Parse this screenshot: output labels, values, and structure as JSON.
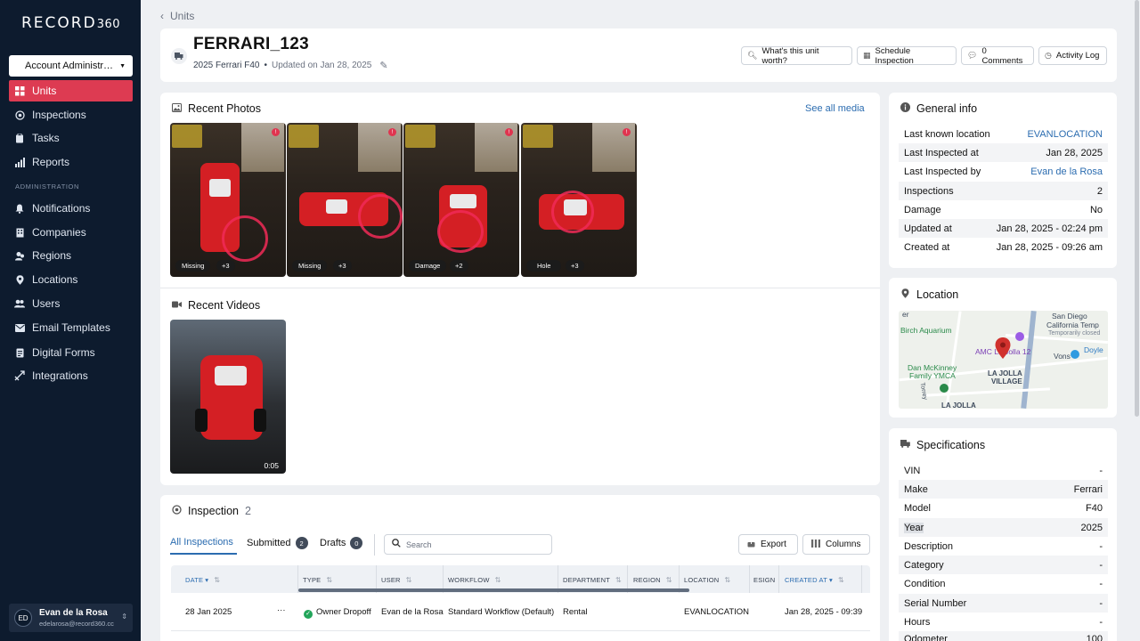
{
  "app": {
    "logo_main": "RECORD",
    "logo_num": "360"
  },
  "sidebar": {
    "account_label": "Account Administr…",
    "items": [
      {
        "label": "Units",
        "icon": "grid-icon"
      },
      {
        "label": "Inspections",
        "icon": "target-icon"
      },
      {
        "label": "Tasks",
        "icon": "clipboard-icon"
      },
      {
        "label": "Reports",
        "icon": "bar-chart-icon"
      },
      {
        "label": "Notifications",
        "icon": "bell-icon"
      },
      {
        "label": "Companies",
        "icon": "building-icon"
      },
      {
        "label": "Regions",
        "icon": "region-icon"
      },
      {
        "label": "Locations",
        "icon": "pin-icon"
      },
      {
        "label": "Users",
        "icon": "users-icon"
      },
      {
        "label": "Email Templates",
        "icon": "mail-icon"
      },
      {
        "label": "Digital Forms",
        "icon": "form-icon"
      },
      {
        "label": "Integrations",
        "icon": "integration-icon"
      }
    ],
    "section_admin": "ADMINISTRATION",
    "user": {
      "initials": "ED",
      "name": "Evan de la Rosa",
      "email": "edelarosa@record360.cc"
    }
  },
  "breadcrumb": {
    "back_label": "Units"
  },
  "unit": {
    "title": "FERRARI_123",
    "subtitle": "2025 Ferrari F40",
    "updated": "Updated on Jan 28, 2025"
  },
  "header_buttons": {
    "worth": "What's this unit worth?",
    "schedule": "Schedule Inspection",
    "comments": "0 Comments",
    "activity": "Activity Log"
  },
  "photos": {
    "title": "Recent Photos",
    "see_all": "See all media",
    "items": [
      {
        "tag": "Missing",
        "more": "+3"
      },
      {
        "tag": "Missing",
        "more": "+3"
      },
      {
        "tag": "Damage",
        "more": "+2"
      },
      {
        "tag": "Hole",
        "more": "+3"
      }
    ]
  },
  "videos": {
    "title": "Recent Videos",
    "items": [
      {
        "duration": "0:05"
      }
    ]
  },
  "general_info": {
    "title": "General info",
    "rows": [
      {
        "label": "Last known location",
        "value": "EVANLOCATION"
      },
      {
        "label": "Last Inspected at",
        "value": "Jan 28, 2025"
      },
      {
        "label": "Last Inspected by",
        "value": "Evan de la Rosa"
      },
      {
        "label": "Inspections",
        "value": "2"
      },
      {
        "label": "Damage",
        "value": "No"
      },
      {
        "label": "Updated at",
        "value": "Jan 28, 2025 - 02:24 pm"
      },
      {
        "label": "Created at",
        "value": "Jan 28, 2025 - 09:26 am"
      }
    ]
  },
  "location": {
    "title": "Location",
    "map_labels": {
      "aquarium": "Birch Aquarium",
      "sd": "San Diego",
      "california": "California Temp",
      "closed": "Temporarily closed",
      "amc": "AMC La Jolla 12",
      "vons": "Vons",
      "doyle": "Doyle",
      "dan1": "Dan McKinney",
      "dan2": "Family YMCA",
      "lj1": "LA JOLLA",
      "lj2": "VILLAGE",
      "lj3": "LA JOLLA",
      "torrey": "Torrey",
      "er": "er"
    }
  },
  "specifications": {
    "title": "Specifications",
    "rows": [
      {
        "label": "VIN",
        "value": "-"
      },
      {
        "label": "Make",
        "value": "Ferrari"
      },
      {
        "label": "Model",
        "value": "F40"
      },
      {
        "label": "Year",
        "value": "2025"
      },
      {
        "label": "Description",
        "value": "-"
      },
      {
        "label": "Category",
        "value": "-"
      },
      {
        "label": "Condition",
        "value": "-"
      },
      {
        "label": "Serial Number",
        "value": "-"
      },
      {
        "label": "Hours",
        "value": "-"
      },
      {
        "label": "Odometer",
        "value": "100"
      }
    ]
  },
  "inspections": {
    "title": "Inspection",
    "count": "2",
    "tabs": {
      "all": "All Inspections",
      "submitted": "Submitted",
      "submitted_count": "2",
      "drafts": "Drafts",
      "drafts_count": "0"
    },
    "search_placeholder": "Search",
    "export_label": "Export",
    "columns_label": "Columns",
    "headers": [
      "DATE",
      "TYPE",
      "USER",
      "WORKFLOW",
      "DEPARTMENT",
      "REGION",
      "LOCATION",
      "ESIGN",
      "CREATED AT"
    ],
    "rows": [
      {
        "date": "28 Jan 2025",
        "menu": "···",
        "type": "Owner Dropoff",
        "user": "Evan de la Rosa",
        "workflow": "Standard Workflow (Default)",
        "department": "Rental",
        "region": "",
        "location": "EVANLOCATION",
        "esign": "",
        "created_at": "Jan 28, 2025 - 09:39"
      }
    ]
  },
  "colors": {
    "sidebar_bg": "#0d1b2e",
    "accent": "#dd3b52",
    "link": "#2b6cb0"
  }
}
